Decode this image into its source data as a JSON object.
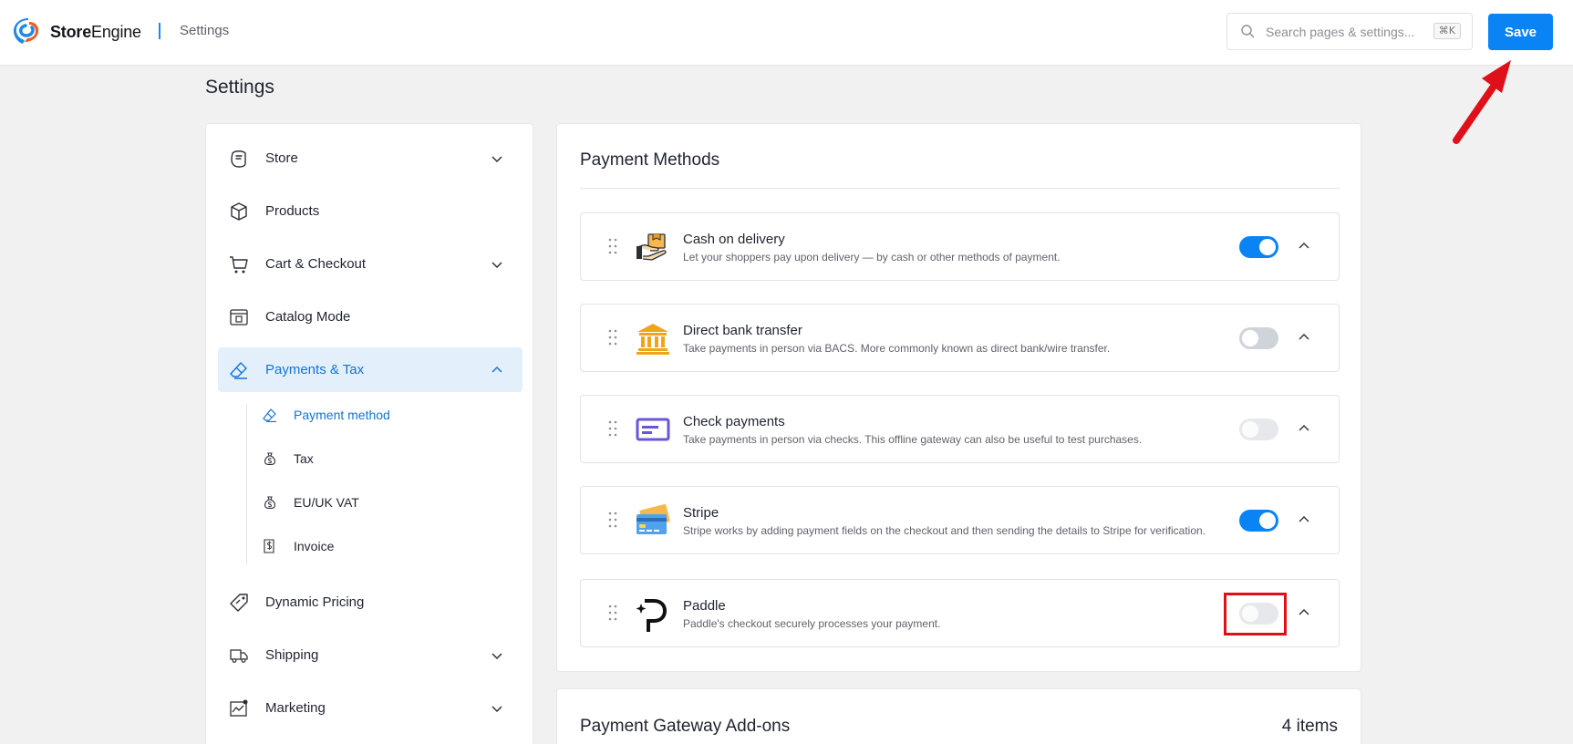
{
  "header": {
    "brand_bold": "Store",
    "brand_rest": "Engine",
    "breadcrumb": "Settings",
    "search_placeholder": "Search pages & settings...",
    "search_shortcut": "⌘K",
    "save_label": "Save"
  },
  "page": {
    "title": "Settings"
  },
  "sidebar": {
    "items": [
      {
        "label": "Store",
        "icon": "store-icon",
        "expandable": true
      },
      {
        "label": "Products",
        "icon": "box-icon",
        "expandable": false
      },
      {
        "label": "Cart & Checkout",
        "icon": "cart-icon",
        "expandable": true
      },
      {
        "label": "Catalog Mode",
        "icon": "catalog-icon",
        "expandable": false
      },
      {
        "label": "Payments & Tax",
        "icon": "eraser-icon",
        "expandable": true,
        "active": true
      },
      {
        "label": "Dynamic Pricing",
        "icon": "tag-icon",
        "expandable": false
      },
      {
        "label": "Shipping",
        "icon": "truck-icon",
        "expandable": true
      },
      {
        "label": "Marketing",
        "icon": "chart-icon",
        "expandable": true
      }
    ],
    "subitems": [
      {
        "label": "Payment method",
        "icon": "eraser-icon",
        "active": true
      },
      {
        "label": "Tax",
        "icon": "money-bag-icon"
      },
      {
        "label": "EU/UK VAT",
        "icon": "money-bag-icon"
      },
      {
        "label": "Invoice",
        "icon": "receipt-icon"
      }
    ]
  },
  "payment_methods": {
    "title": "Payment Methods",
    "items": [
      {
        "name": "Cash on delivery",
        "desc": "Let your shoppers pay upon delivery — by cash or other methods of payment.",
        "icon": "cash-hand-icon",
        "state": "on"
      },
      {
        "name": "Direct bank transfer",
        "desc": "Take payments in person via BACS. More commonly known as direct bank/wire transfer.",
        "icon": "bank-icon",
        "state": "off"
      },
      {
        "name": "Check payments",
        "desc": "Take payments in person via checks. This offline gateway can also be useful to test purchases.",
        "icon": "check-icon",
        "state": "disabled"
      },
      {
        "name": "Stripe",
        "desc": "Stripe works by adding payment fields on the checkout and then sending the details to Stripe for verification.",
        "icon": "credit-card-icon",
        "state": "on"
      },
      {
        "name": "Paddle",
        "desc": "Paddle's checkout securely processes your payment.",
        "icon": "paddle-icon",
        "state": "disabled"
      }
    ]
  },
  "addons": {
    "title": "Payment Gateway Add-ons",
    "count": "4 items"
  },
  "colors": {
    "accent": "#0a84f5",
    "annotation": "#e0101a",
    "active_bg": "#e3f0fc"
  }
}
